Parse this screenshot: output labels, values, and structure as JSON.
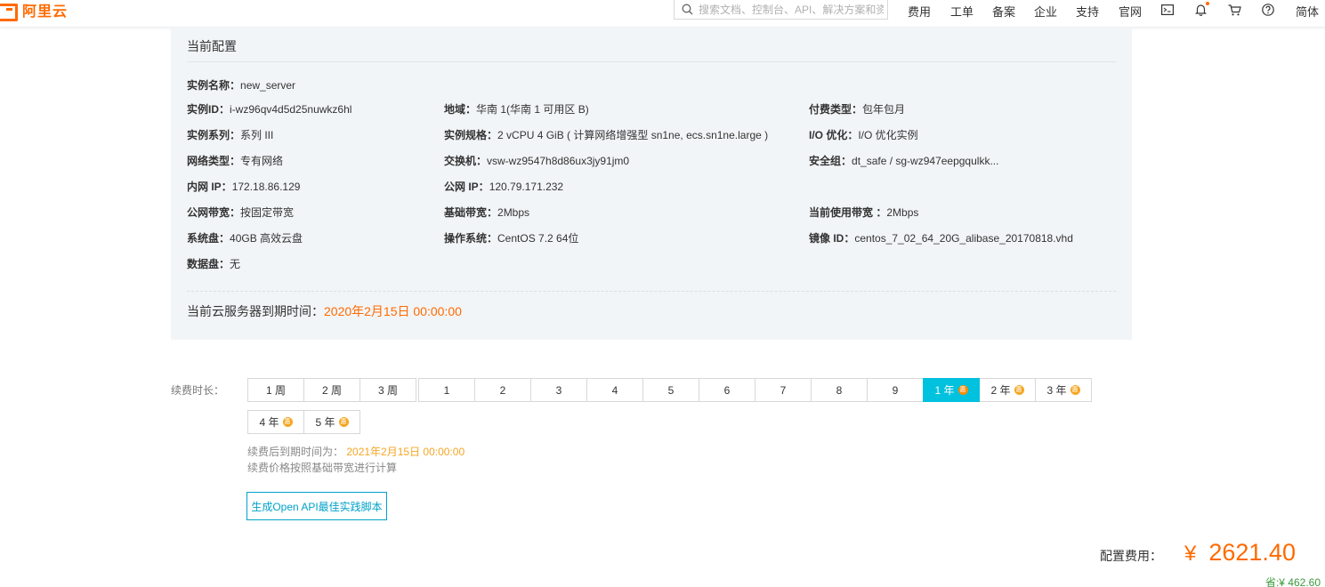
{
  "header": {
    "logo_text": "阿里云",
    "search_placeholder": "搜索文档、控制台、API、解决方案和资源",
    "nav": [
      "费用",
      "工单",
      "备案",
      "企业",
      "支持",
      "官网"
    ],
    "lang": "简体",
    "accent": "#ff6a00"
  },
  "config": {
    "title": "当前配置",
    "instance_name": {
      "k": "实例名称：",
      "v": "new_server"
    },
    "instance_id": {
      "k": "实例ID：",
      "v": "i-wz96qv4d5d25nuwkz6hl"
    },
    "region": {
      "k": "地域：",
      "v": "华南 1(华南 1 可用区 B)"
    },
    "pay_type": {
      "k": "付费类型：",
      "v": "包年包月"
    },
    "family": {
      "k": "实例系列：",
      "v": "系列 III"
    },
    "spec": {
      "k": "实例规格：",
      "v": "2 vCPU 4 GiB ( 计算网络增强型 sn1ne, ecs.sn1ne.large )"
    },
    "io": {
      "k": "I/O 优化：",
      "v": "I/O 优化实例"
    },
    "net_type": {
      "k": "网络类型：",
      "v": "专有网络"
    },
    "vswitch": {
      "k": "交换机：",
      "v": "vsw-wz9547h8d86ux3jy91jm0"
    },
    "sec_group": {
      "k": "安全组：",
      "v": "dt_safe / sg-wz947eepgqulkk..."
    },
    "private_ip": {
      "k": "内网 IP：",
      "v": "172.18.86.129"
    },
    "public_ip": {
      "k": "公网 IP：",
      "v": "120.79.171.232"
    },
    "bw_type": {
      "k": "公网带宽：",
      "v": "按固定带宽"
    },
    "base_bw": {
      "k": "基础带宽：",
      "v": "2Mbps"
    },
    "cur_bw": {
      "k": "当前使用带宽 ：",
      "v": "2Mbps"
    },
    "sys_disk": {
      "k": "系统盘：",
      "v": "40GB 高效云盘"
    },
    "os": {
      "k": "操作系统：",
      "v": "CentOS  7.2 64位"
    },
    "image": {
      "k": "镜像 ID：",
      "v": "centos_7_02_64_20G_alibase_20170818.vhd"
    },
    "data_disk": {
      "k": "数据盘：",
      "v": "无"
    },
    "expire_label": "当前云服务器到期时间：",
    "expire_value": "2020年2月15日 00:00:00"
  },
  "renew": {
    "label": "续费时长：",
    "options_row1": [
      {
        "label": "1 周",
        "badge": false,
        "selected": false
      },
      {
        "label": "2 周",
        "badge": false,
        "selected": false
      },
      {
        "label": "3 周",
        "badge": false,
        "selected": false
      },
      {
        "label": "1",
        "badge": false,
        "selected": false
      },
      {
        "label": "2",
        "badge": false,
        "selected": false
      },
      {
        "label": "3",
        "badge": false,
        "selected": false
      },
      {
        "label": "4",
        "badge": false,
        "selected": false
      },
      {
        "label": "5",
        "badge": false,
        "selected": false
      },
      {
        "label": "6",
        "badge": false,
        "selected": false
      },
      {
        "label": "7",
        "badge": false,
        "selected": false
      },
      {
        "label": "8",
        "badge": false,
        "selected": false
      },
      {
        "label": "9",
        "badge": false,
        "selected": false
      },
      {
        "label": "1 年",
        "badge": true,
        "selected": true
      },
      {
        "label": "2 年",
        "badge": true,
        "selected": false
      },
      {
        "label": "3 年",
        "badge": true,
        "selected": false
      }
    ],
    "options_row2": [
      {
        "label": "4 年",
        "badge": true,
        "selected": false
      },
      {
        "label": "5 年",
        "badge": true,
        "selected": false
      }
    ],
    "badge_text": "惠",
    "after_label": "续费后到期时间为：",
    "after_value": "2021年2月15日 00:00:00",
    "note": "续费价格按照基础带宽进行计算",
    "api_button": "生成Open API最佳实践脚本"
  },
  "fee": {
    "label": "配置费用：",
    "currency": "¥",
    "amount": "2621.40",
    "save": "省:¥ 462.60"
  }
}
